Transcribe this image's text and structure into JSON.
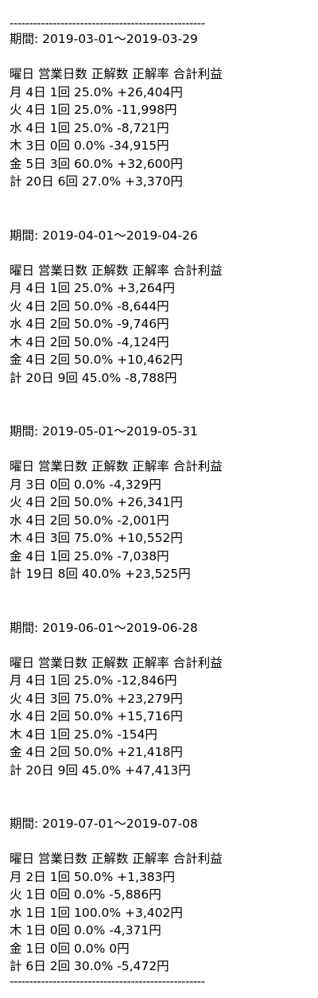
{
  "rule": "--------------------------------------------------",
  "periods": [
    {
      "period": "期間: 2019-03-01～2019-03-29",
      "header": "曜日 営業日数 正解数 正解率 合計利益",
      "rows": [
        "月 4日 1回 25.0% +26,404円",
        "火 4日 1回 25.0% -11,998円",
        "水 4日 1回 25.0% -8,721円",
        "木 3日 0回 0.0% -34,915円",
        "金 5日 3回 60.0% +32,600円",
        "計 20日 6回 27.0% +3,370円"
      ]
    },
    {
      "period": "期間: 2019-04-01～2019-04-26",
      "header": "曜日 営業日数 正解数 正解率 合計利益",
      "rows": [
        "月 4日 1回 25.0% +3,264円",
        "火 4日 2回 50.0% -8,644円",
        "水 4日 2回 50.0% -9,746円",
        "木 4日 2回 50.0% -4,124円",
        "金 4日 2回 50.0% +10,462円",
        "計 20日 9回 45.0% -8,788円"
      ]
    },
    {
      "period": "期間: 2019-05-01～2019-05-31",
      "header": "曜日 営業日数 正解数 正解率 合計利益",
      "rows": [
        "月 3日 0回 0.0% -4,329円",
        "火 4日 2回 50.0% +26,341円",
        "水 4日 2回 50.0% -2,001円",
        "木 4日 3回 75.0% +10,552円",
        "金 4日 1回 25.0% -7,038円",
        "計 19日 8回 40.0% +23,525円"
      ]
    },
    {
      "period": "期間: 2019-06-01～2019-06-28",
      "header": "曜日 営業日数 正解数 正解率 合計利益",
      "rows": [
        "月 4日 1回 25.0% -12,846円",
        "火 4日 3回 75.0% +23,279円",
        "水 4日 2回 50.0% +15,716円",
        "木 4日 1回 25.0% -154円",
        "金 4日 2回 50.0% +21,418円",
        "計 20日 9回 45.0% +47,413円"
      ]
    },
    {
      "period": "期間: 2019-07-01～2019-07-08",
      "header": "曜日 営業日数 正解数 正解率 合計利益",
      "rows": [
        "月 2日 1回 50.0% +1,383円",
        "火 1日 0回 0.0% -5,886円",
        "水 1日 1回 100.0% +3,402円",
        "木 1日 0回 0.0% -4,371円",
        "金 1日 0回 0.0% 0円",
        "計 6日 2回 30.0% -5,472円"
      ]
    }
  ]
}
